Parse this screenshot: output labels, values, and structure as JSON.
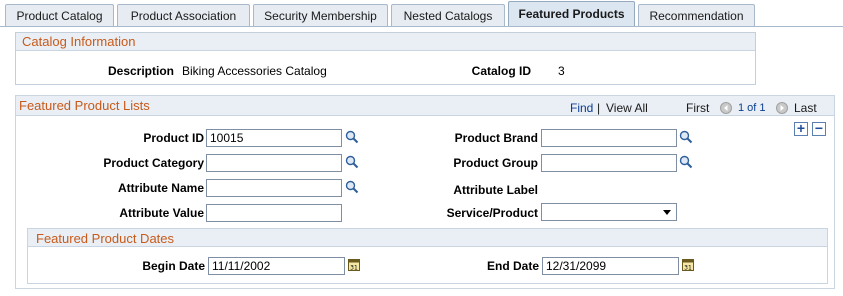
{
  "tabs": [
    {
      "label": "Product Catalog",
      "active": false
    },
    {
      "label": "Product Association",
      "active": false
    },
    {
      "label": "Security Membership",
      "active": false
    },
    {
      "label": "Nested Catalogs",
      "active": false
    },
    {
      "label": "Featured Products",
      "active": true
    },
    {
      "label": "Recommendation",
      "active": false
    }
  ],
  "catalog_info": {
    "title": "Catalog Information",
    "description_label": "Description",
    "description_value": "Biking Accessories Catalog",
    "catalog_id_label": "Catalog ID",
    "catalog_id_value": "3"
  },
  "featured_lists": {
    "title": "Featured Product Lists",
    "nav": {
      "find": "Find",
      "separator": "|",
      "view_all": "View All",
      "first": "First",
      "range": "1 of 1",
      "last": "Last"
    },
    "add_label": "+",
    "remove_label": "−",
    "fields": {
      "product_id_label": "Product ID",
      "product_id_value": "10015",
      "product_brand_label": "Product Brand",
      "product_brand_value": "",
      "product_category_label": "Product Category",
      "product_category_value": "",
      "product_group_label": "Product Group",
      "product_group_value": "",
      "attribute_name_label": "Attribute Name",
      "attribute_name_value": "",
      "attribute_label_label": "Attribute Label",
      "attribute_value_label": "Attribute Value",
      "attribute_value_value": "",
      "service_product_label": "Service/Product",
      "service_product_value": ""
    },
    "dates": {
      "title": "Featured Product Dates",
      "begin_label": "Begin Date",
      "begin_value": "11/11/2002",
      "end_label": "End Date",
      "end_value": "12/31/2099"
    }
  },
  "colors": {
    "section_title": "#c85a1a",
    "header_bg": "#e9eff5",
    "link": "#0b3d91"
  },
  "icons": {
    "lookup": "magnifier-icon",
    "calendar": "calendar-icon",
    "prev": "previous-arrow-icon",
    "next": "next-arrow-icon"
  }
}
